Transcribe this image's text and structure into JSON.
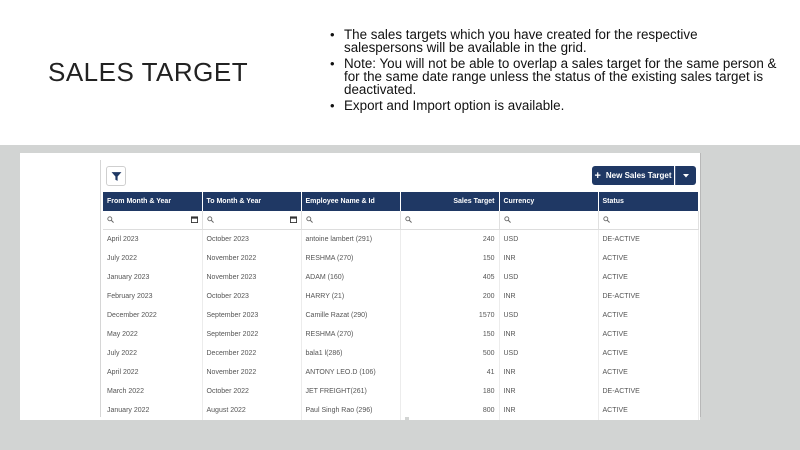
{
  "slide": {
    "title": "SALES TARGET",
    "bullets": [
      "The sales targets which you have created for the respective salespersons will be available  in the grid.",
      "Note: You will not be able to overlap a sales target for the same person & for the same date range unless the status of the existing sales target is deactivated.",
      "Export and Import option is available."
    ]
  },
  "toolbar": {
    "new_button_label": "New Sales Target",
    "new_button_icon": "plus-icon",
    "filter_icon": "filter-icon",
    "dropdown_icon": "chevron-down-icon"
  },
  "grid": {
    "columns": [
      "From Month & Year",
      "To Month & Year",
      "Employee Name & Id",
      "Sales Target",
      "Currency",
      "Status"
    ],
    "rows": [
      [
        "April 2023",
        "October 2023",
        "antoine lambert (291)",
        "240",
        "USD",
        "DE-ACTIVE"
      ],
      [
        "July 2022",
        "November 2022",
        "RESHMA (270)",
        "150",
        "INR",
        "ACTIVE"
      ],
      [
        "January 2023",
        "November 2023",
        "ADAM (160)",
        "405",
        "USD",
        "ACTIVE"
      ],
      [
        "February 2023",
        "October 2023",
        "HARRY (21)",
        "200",
        "INR",
        "DE-ACTIVE"
      ],
      [
        "December 2022",
        "September 2023",
        "Camille Razat (290)",
        "1570",
        "USD",
        "ACTIVE"
      ],
      [
        "May 2022",
        "September 2022",
        "RESHMA (270)",
        "150",
        "INR",
        "ACTIVE"
      ],
      [
        "July 2022",
        "December 2022",
        "bala1 l(286)",
        "500",
        "USD",
        "ACTIVE"
      ],
      [
        "April 2022",
        "November 2022",
        "ANTONY LEO.D (106)",
        "41",
        "INR",
        "ACTIVE"
      ],
      [
        "March 2022",
        "October 2022",
        "JET FREIGHT(261)",
        "180",
        "INR",
        "DE-ACTIVE"
      ],
      [
        "January 2022",
        "August 2022",
        "Paul Singh Rao (296)",
        "800",
        "INR",
        "ACTIVE"
      ]
    ]
  },
  "colors": {
    "header_bg": "#1f3864",
    "band_bg": "#d2d4d3"
  }
}
